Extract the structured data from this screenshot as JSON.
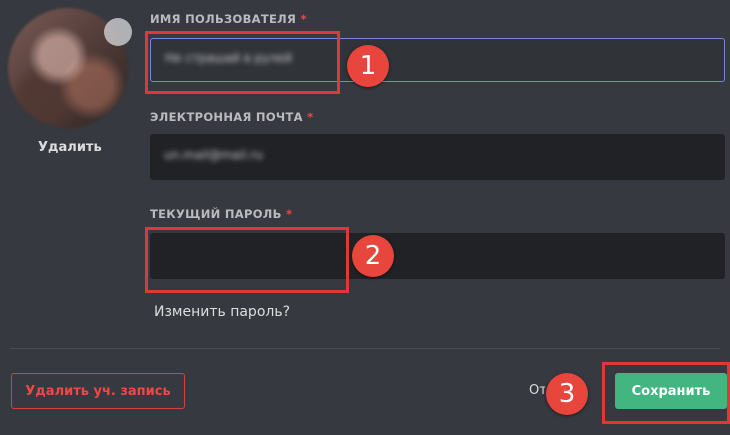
{
  "avatar": {
    "remove_label": "Удалить"
  },
  "form": {
    "username": {
      "label": "ИМЯ ПОЛЬЗОВАТЕЛЯ",
      "required": "*",
      "value": "Не страшай в рулей"
    },
    "email": {
      "label": "ЭЛЕКТРОННАЯ ПОЧТА",
      "required": "*",
      "value": "un.mail@mail.ru"
    },
    "password": {
      "label": "ТЕКУЩИЙ ПАРОЛЬ",
      "required": "*",
      "value": ""
    },
    "change_password_link": "Изменить пароль?"
  },
  "footer": {
    "delete_account_label": "Удалить уч. запись",
    "cancel_label": "Отмена",
    "save_label": "Сохранить"
  },
  "annotations": {
    "marker_1": "1",
    "marker_2": "2",
    "marker_3": "3"
  },
  "colors": {
    "background": "#36393f",
    "input_bg": "#202225",
    "focus_border": "#7289da",
    "save_green": "#43b581",
    "danger_red": "#f04747",
    "highlight_red": "#e03838"
  }
}
